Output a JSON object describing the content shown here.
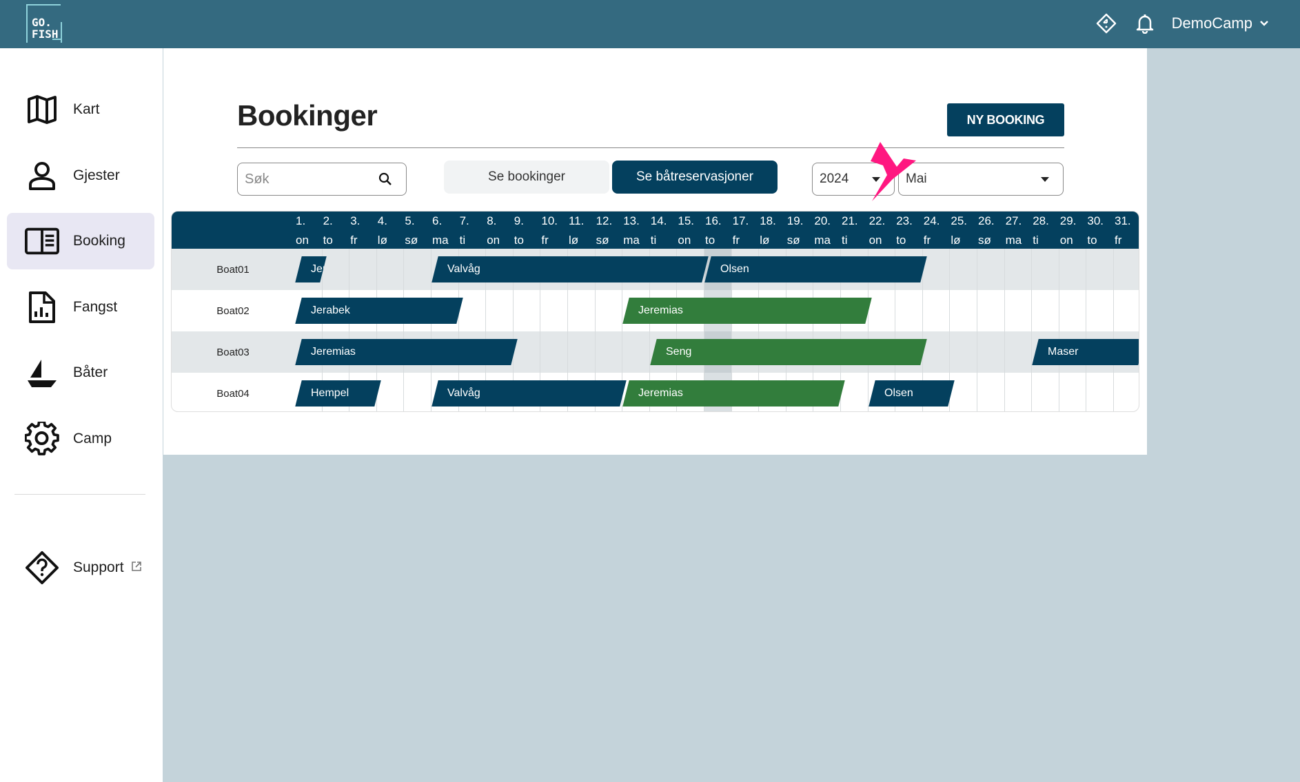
{
  "app": {
    "logo_text": "GO.\nFISH",
    "user_name": "DemoCamp"
  },
  "sidebar": {
    "items": [
      {
        "label": "Kart",
        "icon": "map-icon"
      },
      {
        "label": "Gjester",
        "icon": "person-icon"
      },
      {
        "label": "Booking",
        "icon": "book-icon",
        "active": true
      },
      {
        "label": "Fangst",
        "icon": "report-icon"
      },
      {
        "label": "Båter",
        "icon": "boat-icon"
      },
      {
        "label": "Camp",
        "icon": "gear-icon"
      }
    ],
    "support_label": "Support"
  },
  "page": {
    "title": "Bookinger",
    "new_booking_label": "NY BOOKING"
  },
  "search": {
    "placeholder": "Søk"
  },
  "tabs": {
    "bookings": "Se bookinger",
    "boats": "Se båtreservasjoner",
    "active": "boats"
  },
  "filters": {
    "year": "2024",
    "month": "Mai"
  },
  "calendar": {
    "days": [
      [
        "1.",
        "on"
      ],
      [
        "2.",
        "to"
      ],
      [
        "3.",
        "fr"
      ],
      [
        "4.",
        "lø"
      ],
      [
        "5.",
        "sø"
      ],
      [
        "6.",
        "ma"
      ],
      [
        "7.",
        "ti"
      ],
      [
        "8.",
        "on"
      ],
      [
        "9.",
        "to"
      ],
      [
        "10.",
        "fr"
      ],
      [
        "11.",
        "lø"
      ],
      [
        "12.",
        "sø"
      ],
      [
        "13.",
        "ma"
      ],
      [
        "14.",
        "ti"
      ],
      [
        "15.",
        "on"
      ],
      [
        "16.",
        "to"
      ],
      [
        "17.",
        "fr"
      ],
      [
        "18.",
        "lø"
      ],
      [
        "19.",
        "sø"
      ],
      [
        "20.",
        "ma"
      ],
      [
        "21.",
        "ti"
      ],
      [
        "22.",
        "on"
      ],
      [
        "23.",
        "to"
      ],
      [
        "24.",
        "fr"
      ],
      [
        "25.",
        "lø"
      ],
      [
        "26.",
        "sø"
      ],
      [
        "27.",
        "ma"
      ],
      [
        "28.",
        "ti"
      ],
      [
        "29.",
        "on"
      ],
      [
        "30.",
        "to"
      ],
      [
        "31.",
        "fr"
      ]
    ],
    "today_day": 16,
    "boats": [
      "Boat01",
      "Boat02",
      "Boat03",
      "Boat04"
    ],
    "reservations": [
      {
        "boat": 0,
        "name": "Jeremias",
        "start": 1,
        "end": 2,
        "color": "#04405e"
      },
      {
        "boat": 0,
        "name": "Valvåg",
        "start": 6,
        "end": 16,
        "color": "#04405e"
      },
      {
        "boat": 0,
        "name": "Olsen",
        "start": 16,
        "end": 24,
        "color": "#04405e"
      },
      {
        "boat": 1,
        "name": "Jerabek",
        "start": 1,
        "end": 7,
        "color": "#04405e"
      },
      {
        "boat": 1,
        "name": "Jeremias",
        "start": 13,
        "end": 22,
        "color": "#327d3c"
      },
      {
        "boat": 2,
        "name": "Jeremias",
        "start": 1,
        "end": 9,
        "color": "#04405e"
      },
      {
        "boat": 2,
        "name": "Seng",
        "start": 14,
        "end": 24,
        "color": "#327d3c"
      },
      {
        "boat": 2,
        "name": "Maser",
        "start": 28,
        "end": 32,
        "color": "#04405e"
      },
      {
        "boat": 3,
        "name": "Hempel",
        "start": 1,
        "end": 4,
        "color": "#04405e"
      },
      {
        "boat": 3,
        "name": "Valvåg",
        "start": 6,
        "end": 13,
        "color": "#04405e"
      },
      {
        "boat": 3,
        "name": "Jeremias",
        "start": 13,
        "end": 21,
        "color": "#327d3c"
      },
      {
        "boat": 3,
        "name": "Olsen",
        "start": 22,
        "end": 25,
        "color": "#04405e"
      }
    ]
  },
  "colors": {
    "topbar": "#346a80",
    "primary": "#04405e",
    "green": "#327d3c",
    "pointer": "#ff1780"
  }
}
